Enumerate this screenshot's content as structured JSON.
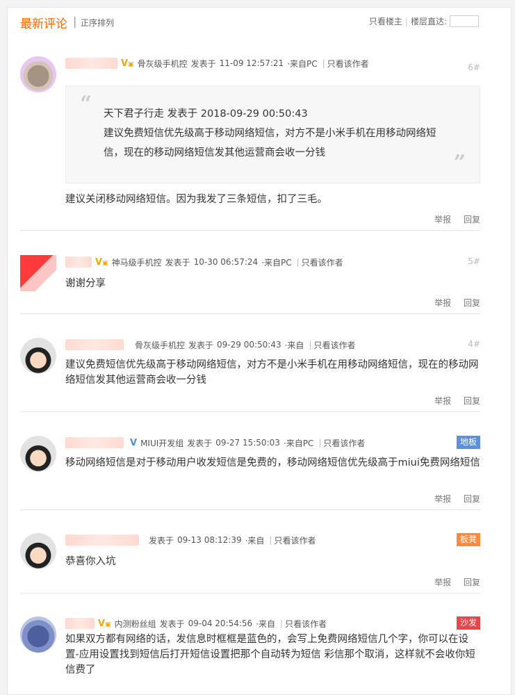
{
  "header": {
    "title": "最新评论",
    "separator": "|",
    "sort_label": "正序排列",
    "only_op": "只看楼主",
    "pipe": "|",
    "floor_jump": "楼层直达:"
  },
  "actions": {
    "report": "举报",
    "reply": "回复"
  },
  "comments": [
    {
      "level": "骨灰级手机控",
      "posted_label": "发表于",
      "time": "11-09 12:57:21",
      "source": "·来自PC",
      "view_author": "只看该作者",
      "floor": "6#",
      "quote": {
        "author_line": "天下君子行走 发表于 2018-09-29 00:50:43",
        "content": "建议免费短信优先级高于移动网络短信，对方不是小米手机在用移动网络短信，现在的移动网络短信发其他运营商会收一分钱"
      },
      "content": "建议关闭移动网络短信。因为我发了三条短信，扣了三毛。"
    },
    {
      "level": "神马级手机控",
      "posted_label": "发表于",
      "time": "10-30 06:57:24",
      "source": "·来自PC",
      "view_author": "只看该作者",
      "floor": "5#",
      "content": "谢谢分享"
    },
    {
      "level": "骨灰级手机控",
      "posted_label": "发表于",
      "time": "09-29 00:50:43",
      "source": "·来自",
      "view_author": "只看该作者",
      "floor": "4#",
      "content": "建议免费短信优先级高于移动网络短信，对方不是小米手机在用移动网络短信，现在的移动网络短信发其他运营商会收一分钱"
    },
    {
      "level": "MIUI开发组",
      "posted_label": "发表于",
      "time": "09-27 15:50:03",
      "source": "·来自PC",
      "view_author": "只看该作者",
      "badge": "地板",
      "badge_color": "#5b8fe0",
      "content": "移动网络短信是对于移动用户收发短信是免费的，移动网络短信优先级高于miui免费网络短信"
    },
    {
      "posted_label": "发表于",
      "time": "09-13 08:12:39",
      "source": "·来自",
      "view_author": "只看该作者",
      "badge": "板凳",
      "badge_color": "#ff8a3d",
      "content": "恭喜你入坑"
    },
    {
      "level": "内测粉丝组",
      "posted_label": "发表于",
      "time": "09-04 20:54:56",
      "source": "·来自",
      "view_author": "只看该作者",
      "badge": "沙发",
      "badge_color": "#e8464b",
      "content": "如果双方都有网络的话，发信息时框框是蓝色的，会写上免费网络短信几个字，你可以在设置-应用设置找到短信后打开短信设置把那个自动转为短信 彩信那个取消，这样就不会收你短信费了"
    }
  ]
}
